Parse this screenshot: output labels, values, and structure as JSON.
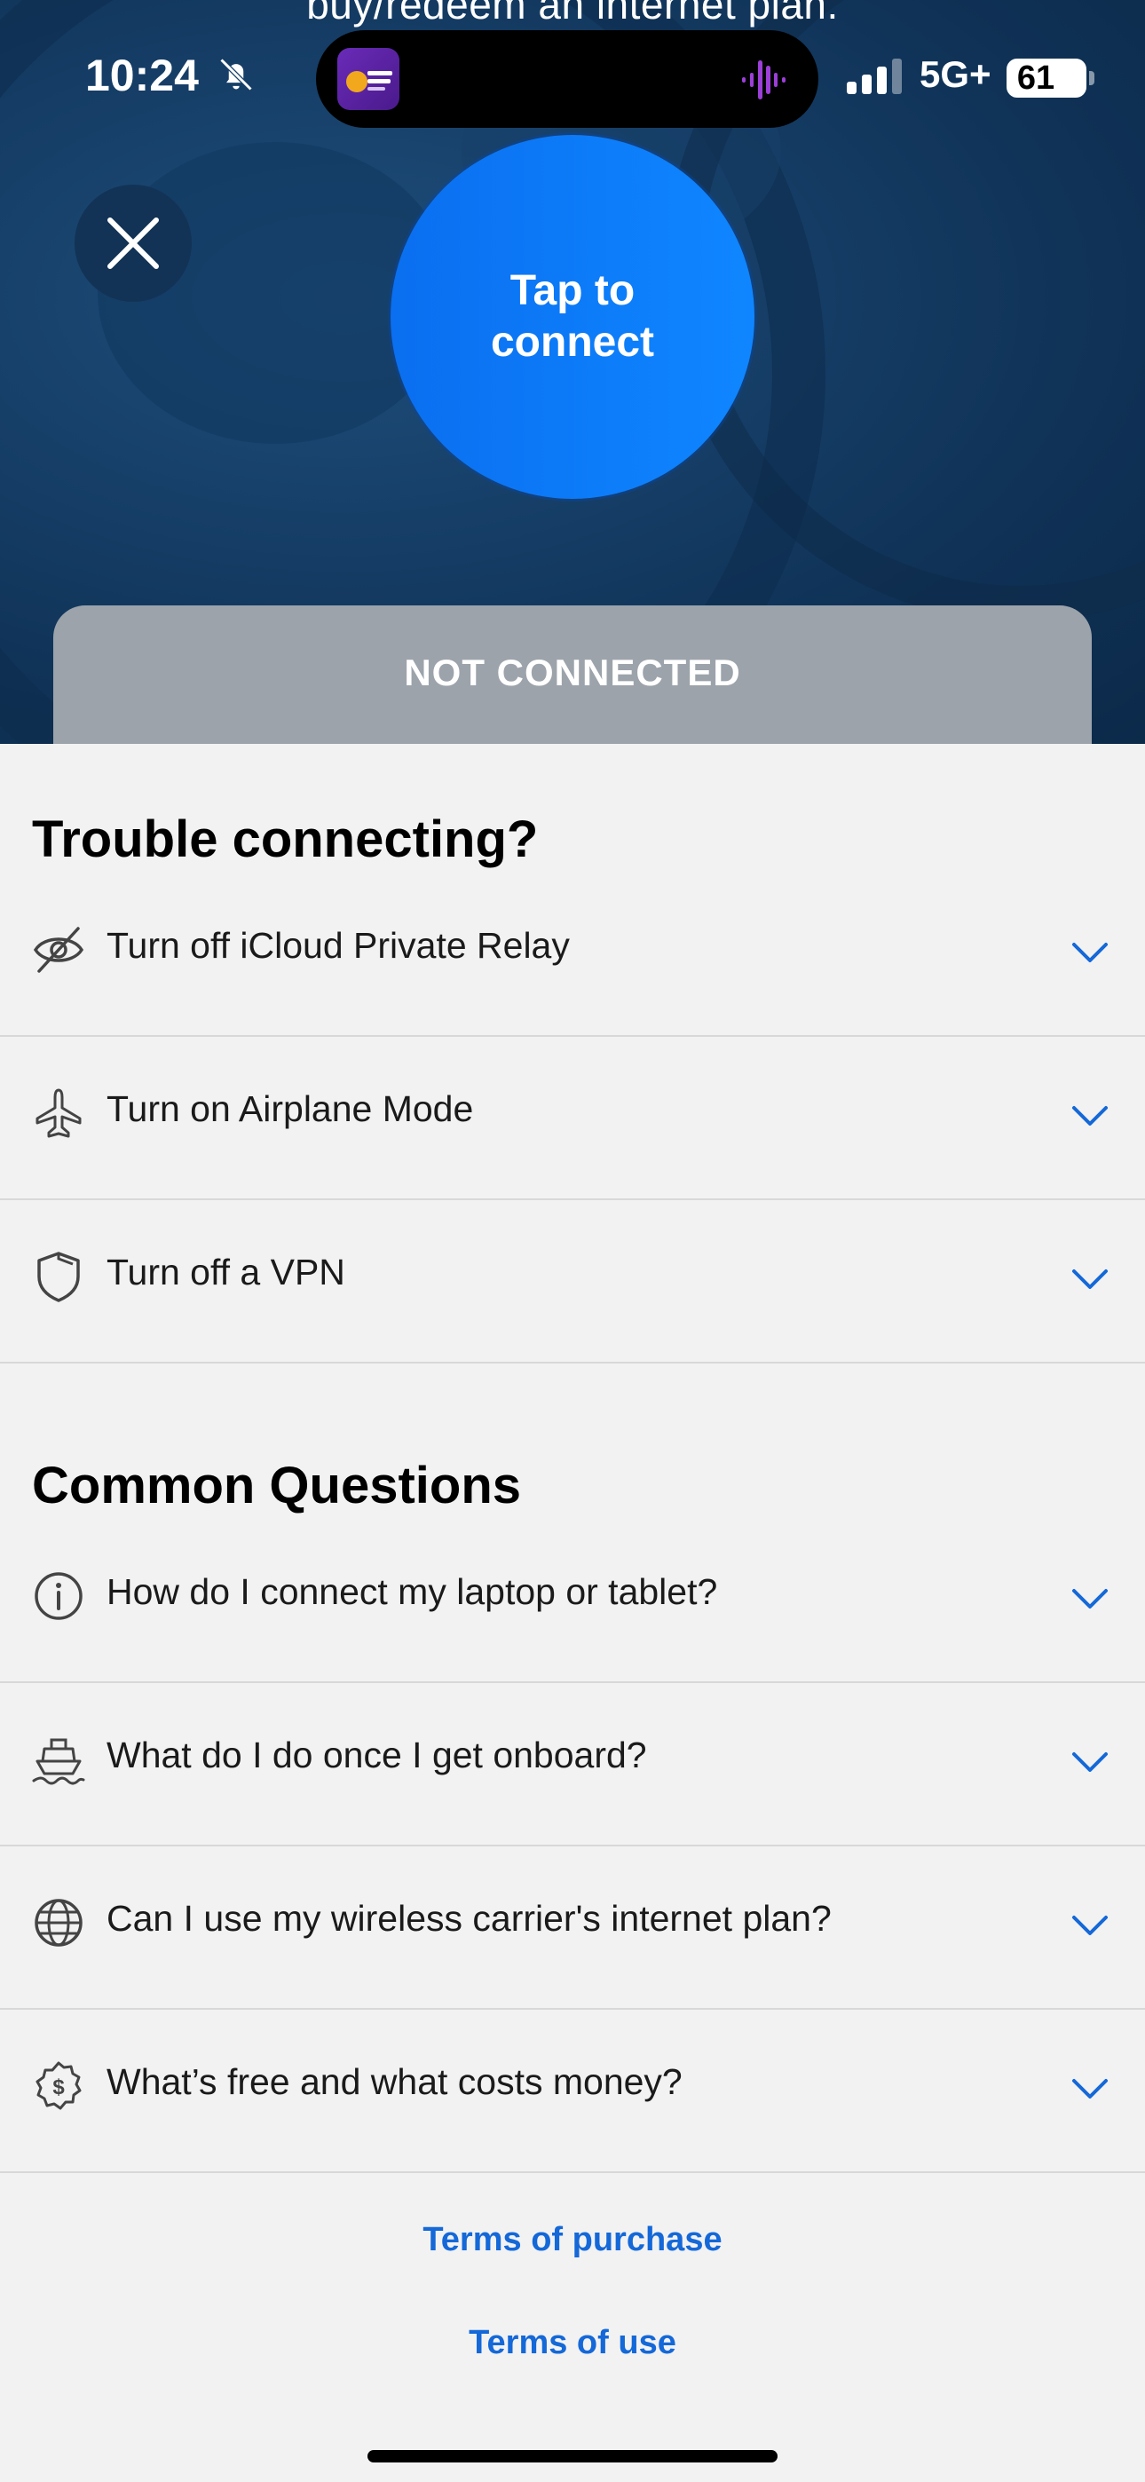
{
  "banner": {
    "text": "buy/redeem an internet plan."
  },
  "status_bar": {
    "time": "10:24",
    "network": "5G+",
    "battery": "61",
    "battery_level": 0.61
  },
  "connect_button": {
    "label": "Tap to connect"
  },
  "connection_status": "NOT CONNECTED",
  "trouble": {
    "title": "Trouble connecting?",
    "items": [
      {
        "label": "Turn off iCloud Private Relay",
        "icon": "eye-off-icon"
      },
      {
        "label": "Turn on Airplane Mode",
        "icon": "airplane-icon"
      },
      {
        "label": "Turn off a VPN",
        "icon": "shield-icon"
      }
    ]
  },
  "questions": {
    "title": "Common Questions",
    "items": [
      {
        "label": "How do I connect my laptop or tablet?",
        "icon": "info-icon"
      },
      {
        "label": "What do I do once I get onboard?",
        "icon": "ship-icon"
      },
      {
        "label": "Can I use my wireless carrier's internet plan?",
        "icon": "globe-icon"
      },
      {
        "label": "What’s free and what costs money?",
        "icon": "dollar-badge-icon"
      }
    ]
  },
  "links": {
    "purchase": "Terms of purchase",
    "use": "Terms of use"
  },
  "colors": {
    "accent": "#1468d8",
    "connect": "#0f86ff",
    "status_card": "#9ca3ab",
    "hero": "#0f3155"
  }
}
